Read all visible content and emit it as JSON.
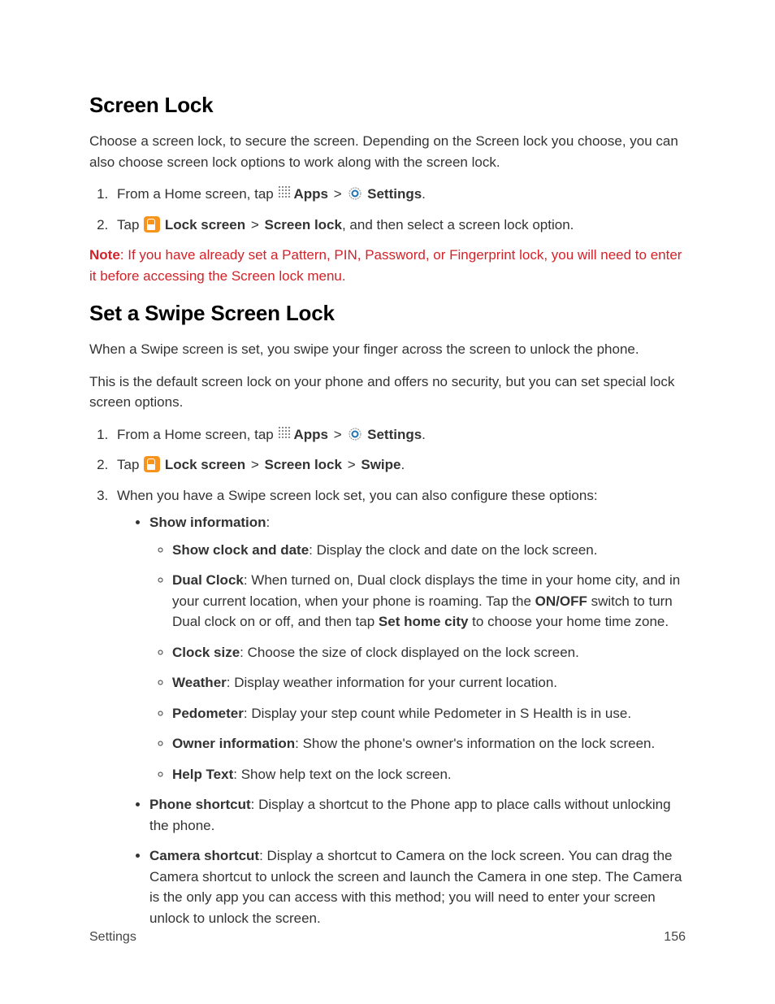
{
  "h1": "Screen Lock",
  "p1": "Choose a screen lock, to secure the screen. Depending on the Screen lock you choose, you can also choose screen lock options to work along with the screen lock.",
  "s1": {
    "step1": {
      "pre": "From a Home screen, tap ",
      "apps": "Apps",
      "settings": "Settings",
      "period": "."
    },
    "step2": {
      "pre": "Tap ",
      "lockscreen": "Lock screen",
      "screenlock": "Screen lock",
      "tail": ", and then select a screen lock option."
    }
  },
  "note": {
    "label": "Note",
    "text": ": If you have already set a Pattern, PIN, Password, or Fingerprint lock, you will need to enter it before accessing the Screen lock menu."
  },
  "h2": "Set a Swipe Screen Lock",
  "p2a": "When a Swipe screen is set, you swipe your finger across the screen to unlock the phone.",
  "p2b": "This is the default screen lock on your phone and offers no security, but you can set special lock screen options.",
  "s2": {
    "step1": {
      "pre": "From a Home screen, tap ",
      "apps": "Apps",
      "settings": "Settings",
      "period": "."
    },
    "step2": {
      "pre": "Tap ",
      "lockscreen": "Lock screen",
      "screenlock": "Screen lock",
      "swipe": "Swipe",
      "period": "."
    },
    "step3": {
      "intro": "When you have a Swipe screen lock set, you can also configure these options:",
      "showinfo": {
        "label": "Show information",
        "colon": ":",
        "items": {
          "clockdate": {
            "label": "Show clock and date",
            "text": ": Display the clock and date on the lock screen."
          },
          "dualclock": {
            "label": "Dual Clock",
            "text1": ": When turned on, Dual clock displays the time in your home city, and in your current location, when your phone is roaming. Tap the ",
            "onoff": "ON/OFF",
            "text2": " switch to turn Dual clock on or off, and then tap ",
            "sethome": "Set home city",
            "text3": " to choose your home time zone."
          },
          "clocksize": {
            "label": "Clock size",
            "text": ": Choose the size of clock displayed on the lock screen."
          },
          "weather": {
            "label": "Weather",
            "text": ": Display weather information for your current location."
          },
          "pedometer": {
            "label": "Pedometer",
            "text": ": Display your step count while Pedometer in S Health is in use."
          },
          "owner": {
            "label": "Owner information",
            "text": ": Show the phone's owner's information on the lock screen."
          },
          "helptext": {
            "label": "Help Text",
            "text": ": Show help text on the lock screen."
          }
        }
      },
      "phoneshortcut": {
        "label": "Phone shortcut",
        "text": ": Display a shortcut to the Phone app to place calls without unlocking the phone."
      },
      "camerashortcut": {
        "label": "Camera shortcut",
        "text": ": Display a shortcut to Camera on the lock screen. You can drag the Camera shortcut to unlock the screen and launch the Camera in one step. The Camera is the only app you can access with this method; you will need to enter your screen unlock to unlock the screen."
      }
    }
  },
  "footer": {
    "left": "Settings",
    "right": "156"
  },
  "gt": ">"
}
